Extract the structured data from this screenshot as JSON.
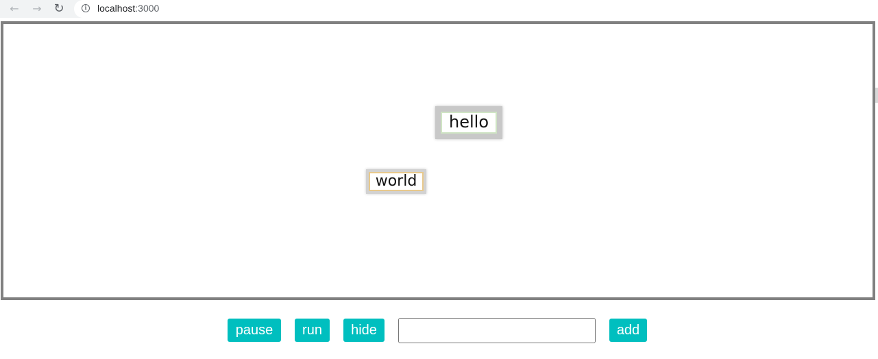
{
  "browser": {
    "url_host": "localhost",
    "url_port": ":3000",
    "icons": {
      "back": "arrow-left",
      "forward": "arrow-right",
      "reload": "reload",
      "info": "info-circle"
    }
  },
  "stage": {
    "tags": [
      {
        "text": "hello",
        "border_color": "#cfe4c4"
      },
      {
        "text": "world",
        "border_color": "#e8c98c"
      }
    ]
  },
  "controls": {
    "pause_label": "pause",
    "run_label": "run",
    "hide_label": "hide",
    "input_value": "",
    "input_placeholder": "",
    "add_label": "add",
    "button_color": "#00bfbf"
  }
}
